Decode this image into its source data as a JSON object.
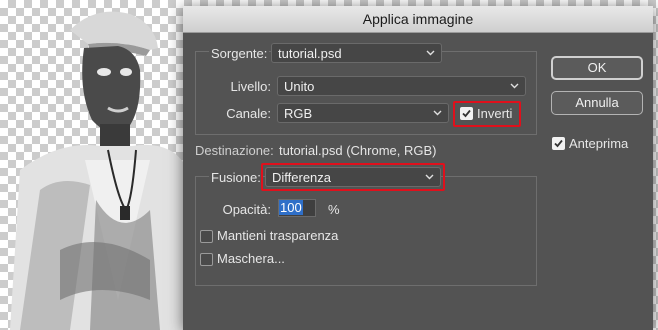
{
  "dialog": {
    "title": "Applica immagine",
    "source": {
      "label": "Sorgente:",
      "value": "tutorial.psd",
      "layer_label": "Livello:",
      "layer_value": "Unito",
      "channel_label": "Canale:",
      "channel_value": "RGB",
      "invert_label": "Inverti",
      "invert_checked": true
    },
    "target": {
      "label": "Destinazione:",
      "value": "tutorial.psd (Chrome, RGB)"
    },
    "blending": {
      "label": "Fusione:",
      "value": "Differenza",
      "opacity_label": "Opacità:",
      "opacity_value": "100",
      "opacity_unit": "%",
      "preserve_transparency_label": "Mantieni trasparenza",
      "preserve_transparency_checked": false,
      "mask_label": "Maschera...",
      "mask_checked": false
    },
    "buttons": {
      "ok": "OK",
      "cancel": "Annulla"
    },
    "preview": {
      "label": "Anteprima",
      "checked": true
    }
  },
  "colors": {
    "dialog_bg": "#535353",
    "highlight": "#e0101c",
    "selection": "#2f6fc8"
  }
}
